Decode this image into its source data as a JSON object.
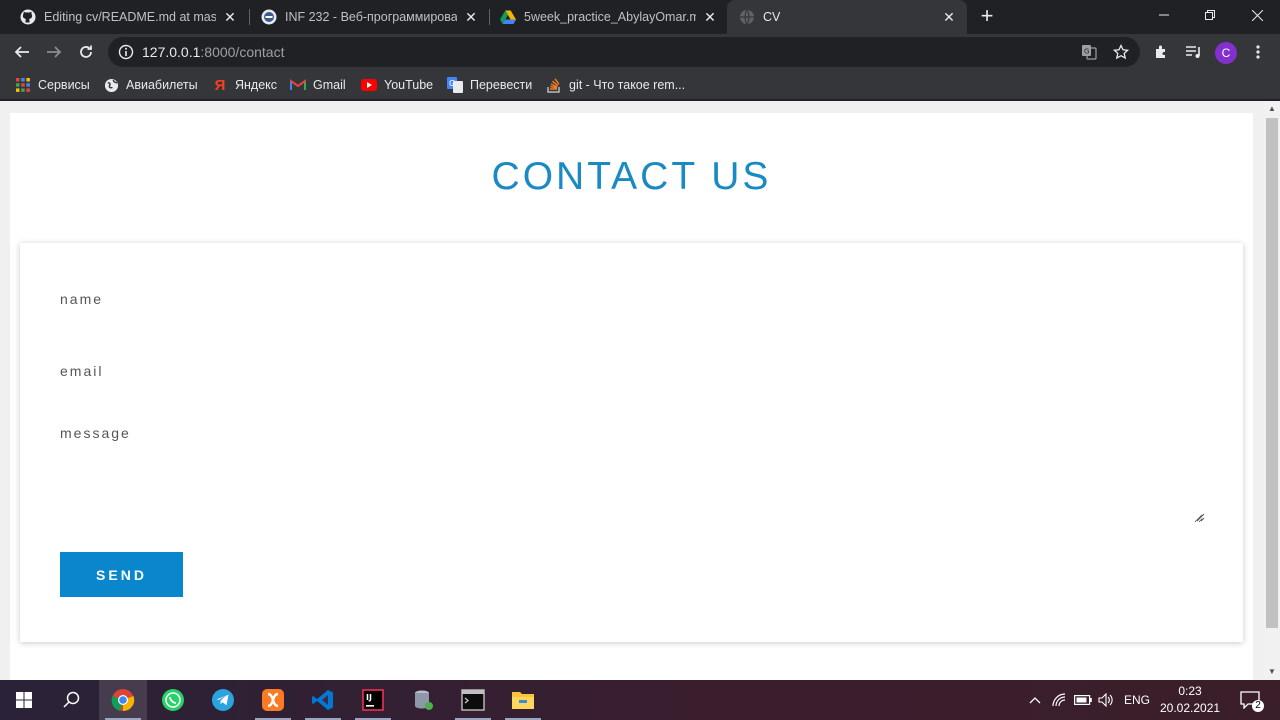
{
  "tabs": [
    {
      "title": "Editing cv/README.md at master",
      "icon": "github-icon"
    },
    {
      "title": "INF 232 - Веб-программирован",
      "icon": "university-icon"
    },
    {
      "title": "5week_practice_AbylayOmar.mp",
      "icon": "google-drive-icon"
    },
    {
      "title": "CV",
      "icon": "globe-icon",
      "active": true
    }
  ],
  "address": {
    "host": "127.0.0.1",
    "path": ":8000/contact"
  },
  "profile_initial": "C",
  "bookmarks": [
    {
      "label": "Сервисы",
      "icon": "apps-grid-icon"
    },
    {
      "label": "Авиабилеты",
      "icon": "globe-icon"
    },
    {
      "label": "Яндекс",
      "icon": "yandex-icon"
    },
    {
      "label": "Gmail",
      "icon": "gmail-icon"
    },
    {
      "label": "YouTube",
      "icon": "youtube-icon"
    },
    {
      "label": "Перевести",
      "icon": "translate-icon"
    },
    {
      "label": "git - Что такое rem...",
      "icon": "stackoverflow-icon"
    }
  ],
  "page": {
    "title": "CONTACT US",
    "form": {
      "name_placeholder": "name",
      "email_placeholder": "email",
      "message_placeholder": "message",
      "send_label": "SEND"
    }
  },
  "taskbar": {
    "apps": [
      "windows-start-icon",
      "search-icon",
      "chrome-icon",
      "whatsapp-icon",
      "telegram-icon",
      "xampp-icon",
      "vscode-icon",
      "intellij-icon",
      "database-icon",
      "terminal-icon",
      "file-explorer-icon"
    ],
    "language": "ENG",
    "time": "0:23",
    "date": "20.02.2021",
    "notifications": "2"
  },
  "colors": {
    "accent": "#1a8ac4",
    "button": "#0a87cc"
  }
}
